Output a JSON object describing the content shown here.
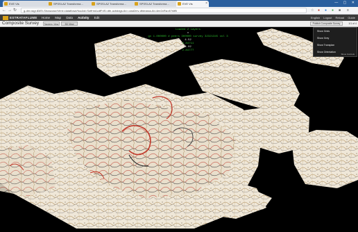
{
  "browser": {
    "tabs": [
      {
        "label": "EVE Vis",
        "active": false,
        "color": "#d9a21b"
      },
      {
        "label": "SPSSI-A2 Transforma…",
        "active": false,
        "color": "#d9a21b"
      },
      {
        "label": "SPSSI-A2 Transforma…",
        "active": false,
        "color": "#d9a21b"
      },
      {
        "label": "SPSSI-A2 Transforma…",
        "active": false,
        "color": "#d9a21b"
      },
      {
        "label": "EVE Vis",
        "active": true,
        "color": "#d9a21b"
      }
    ],
    "window_controls": "— ▢ ✕",
    "url": "g-dev.ragr.83/Ei-Showcase/Ver#=dataflow#/foo&id=SoffrmAcdfFdS=dfe-acbddgs-6d.r-dad2mv-dfdeasss-8d-4ee2cRa=87t4fB"
  },
  "appnav": {
    "brand": "ESTRATAFLUME",
    "menu": [
      "Home",
      "Map",
      "Data",
      "Activity",
      "Edit"
    ],
    "active_menu": "Activity",
    "user_links": [
      "English",
      "Logout",
      "Reload",
      "Guide"
    ]
  },
  "subbar": {
    "title": "Composite Survey",
    "view_buttons": [
      "Tandem View",
      "3D View"
    ],
    "publish_button": "Publish Composite Survey",
    "pager": "1/1 of 4"
  },
  "readout": {
    "header": "Loaded 2 Layers",
    "line1_label": "x",
    "line2": "gx  1.000000  # peers  300000  survey  32321345  vol 3",
    "value1": "4.52",
    "value2": "2.84711",
    "value3": "4.02",
    "value4": "2.84777"
  },
  "dropdown": {
    "items": [
      "Show Grids",
      "Show Grey",
      "Show Transplan",
      "Show Orientation"
    ],
    "footer": "Show Controls"
  },
  "colors": {
    "browser_tab_strip": "#2a5f9e",
    "app_nav": "#3a3a3a",
    "readout_text": "#2fbf2f",
    "seismic_red": "#c0392b"
  }
}
